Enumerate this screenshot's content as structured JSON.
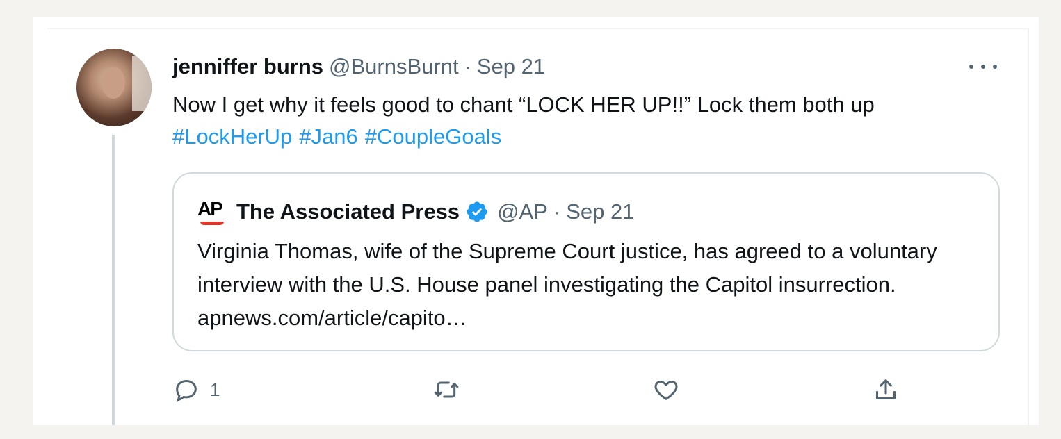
{
  "tweet": {
    "author_name": "jenniffer burns",
    "author_handle": "@BurnsBurnt",
    "separator": "·",
    "date": "Sep 21",
    "text": "Now I get why it feels good to chant “LOCK HER UP!!” Lock them both up",
    "hashtags": [
      "#LockHerUp",
      "#Jan6",
      "#CoupleGoals"
    ]
  },
  "quoted_tweet": {
    "logo_text": "AP",
    "author_name": "The Associated Press",
    "author_handle": "@AP",
    "separator": "·",
    "date": "Sep 21",
    "text": "Virginia Thomas, wife of the Supreme Court justice, has agreed to a voluntary interview with the U.S. House panel investigating the Capitol insurrection. apnews.com/article/capito…"
  },
  "actions": {
    "reply_count": "1",
    "icons": [
      "reply-icon",
      "retweet-icon",
      "like-icon",
      "share-icon"
    ]
  },
  "colors": {
    "link": "#1d9bf0",
    "secondary_text": "#536471",
    "verified": "#1d9bf0"
  }
}
